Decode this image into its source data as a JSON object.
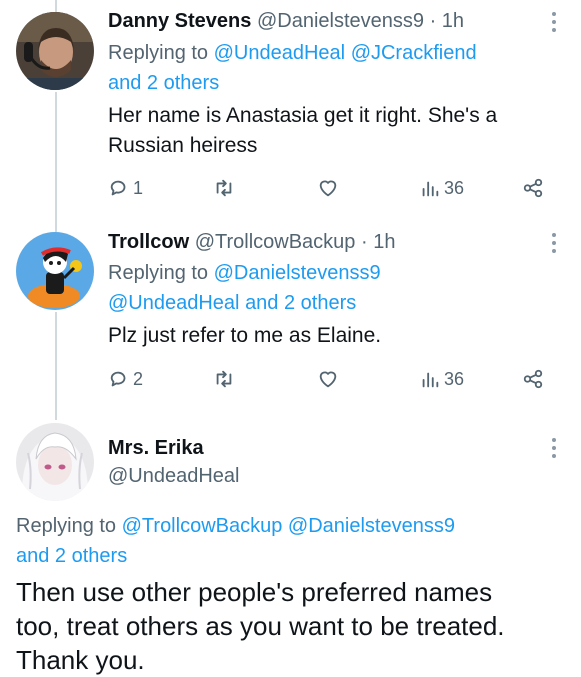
{
  "tweets": [
    {
      "name": "Danny Stevens",
      "handle": "@Danielstevenss9",
      "time": " · 1h",
      "replying_prefix": "Replying to ",
      "mentions": [
        "@UndeadHeal",
        "@JCrackfiend"
      ],
      "others": "and 2 others",
      "text_lines": [
        "Her name is Anastasia get it right. She's a",
        "Russian heiress"
      ],
      "actions": {
        "replies": "1",
        "retweets": "",
        "likes": "",
        "views": "36"
      }
    },
    {
      "name": "Trollcow",
      "handle": "@TrollcowBackup",
      "time": " · 1h",
      "replying_prefix": "Replying to ",
      "mentions": [
        "@Danielstevenss9",
        "@UndeadHeal"
      ],
      "others": "and 2 others",
      "text_lines": [
        "Plz just refer to me as Elaine."
      ],
      "actions": {
        "replies": "2",
        "retweets": "",
        "likes": "",
        "views": "36"
      }
    },
    {
      "name": "Mrs. Erika",
      "handle": "@UndeadHeal",
      "replying_prefix": "Replying to ",
      "mentions": [
        "@TrollcowBackup",
        "@Danielstevenss9"
      ],
      "others": "and 2 others",
      "text_lines": [
        "Then use other people's preferred names",
        "too, treat others as you want to be treated.",
        "Thank you."
      ]
    }
  ],
  "colors": {
    "link": "#1d9bf0",
    "secondary": "#536471",
    "text": "#0f1419",
    "thread_line": "#cfd9de"
  },
  "icons": [
    "reply-icon",
    "retweet-icon",
    "like-icon",
    "views-icon",
    "share-icon",
    "more-icon"
  ]
}
